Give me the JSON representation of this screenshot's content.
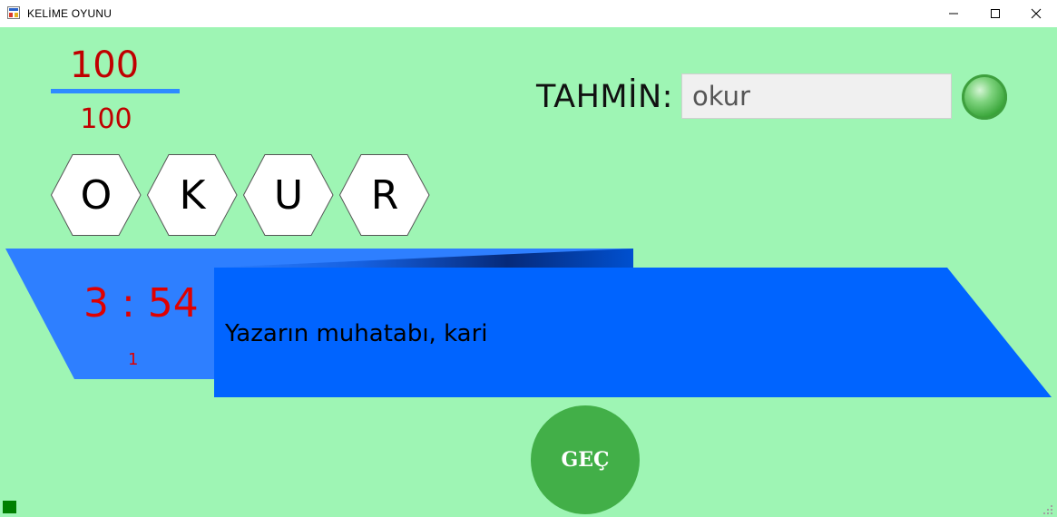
{
  "window": {
    "title": "KELİME OYUNU",
    "icons": {
      "app": "app-icon",
      "minimize": "minimize-icon",
      "maximize": "maximize-icon",
      "close": "close-icon"
    }
  },
  "score": {
    "current": "100",
    "total": "100"
  },
  "guess": {
    "label": "TAHMİN:",
    "value": "okur",
    "submit_icon": "green-round-button-icon"
  },
  "tiles": [
    "O",
    "K",
    "U",
    "R"
  ],
  "timer": {
    "display": "3 : 54",
    "round": "1"
  },
  "clue": {
    "text": "Yazarın muhatabı, kari"
  },
  "pass_button": {
    "label": "GEÇ"
  },
  "colors": {
    "background": "#9ef5b4",
    "score_text": "#c00000",
    "timer_text": "#e00000",
    "timer_panel": "#2e7fff",
    "clue_panel": "#0064ff",
    "pass_button": "#42af48"
  }
}
